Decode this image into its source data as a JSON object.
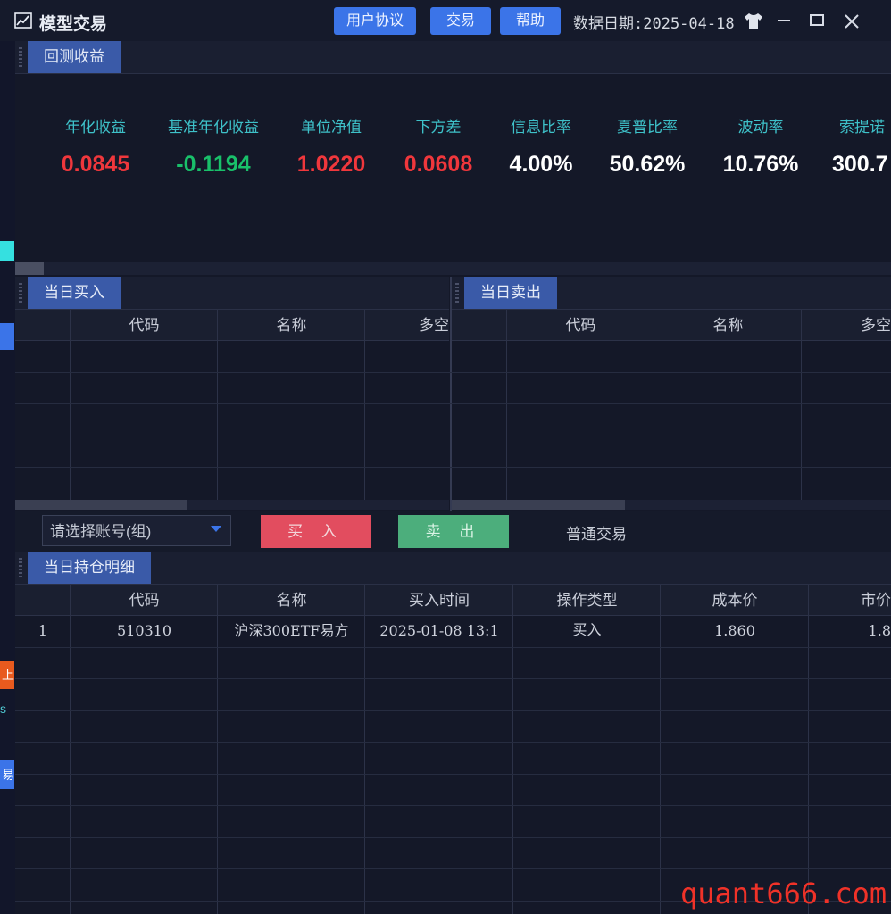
{
  "window": {
    "title": "模型交易",
    "buttons": [
      "用户协议",
      "交易",
      "帮助"
    ],
    "data_date": "数据日期:2025-04-18"
  },
  "backtest": {
    "tab": "回测收益",
    "metrics": [
      {
        "label": "年化收益",
        "value": "0.0845",
        "color": "#f0373c"
      },
      {
        "label": "基准年化收益",
        "value": "-0.1194",
        "color": "#19c06a"
      },
      {
        "label": "单位净值",
        "value": "1.0220",
        "color": "#f0373c"
      },
      {
        "label": "下方差",
        "value": "0.0608",
        "color": "#f0373c"
      },
      {
        "label": "信息比率",
        "value": "4.00%",
        "color": "#ffffff"
      },
      {
        "label": "夏普比率",
        "value": "50.62%",
        "color": "#ffffff"
      },
      {
        "label": "波动率",
        "value": "10.76%",
        "color": "#ffffff"
      },
      {
        "label": "索提诺",
        "value": "300.7",
        "color": "#ffffff"
      }
    ]
  },
  "buy_panel": {
    "tab": "当日买入",
    "columns": [
      "代码",
      "名称",
      "多空"
    ]
  },
  "sell_panel": {
    "tab": "当日卖出",
    "columns": [
      "代码",
      "名称",
      "多空"
    ]
  },
  "trade_bar": {
    "account_placeholder": "请选择账号(组)",
    "buy_label": "买 入",
    "sell_label": "卖 出",
    "mode_label": "普通交易"
  },
  "positions": {
    "tab": "当日持仓明细",
    "columns": [
      "代码",
      "名称",
      "买入时间",
      "操作类型",
      "成本价",
      "市价"
    ],
    "rows": [
      {
        "index": "1",
        "code": "510310",
        "name": "沪深300ETF易方",
        "buy_time": "2025-01-08 13:1",
        "op_type": "买入",
        "cost": "1.860",
        "market": "1.8"
      }
    ]
  },
  "left_strip": {
    "tab_top": "上",
    "tab_s": "s",
    "tab_bottom": "易"
  },
  "watermark": "quant666.com"
}
